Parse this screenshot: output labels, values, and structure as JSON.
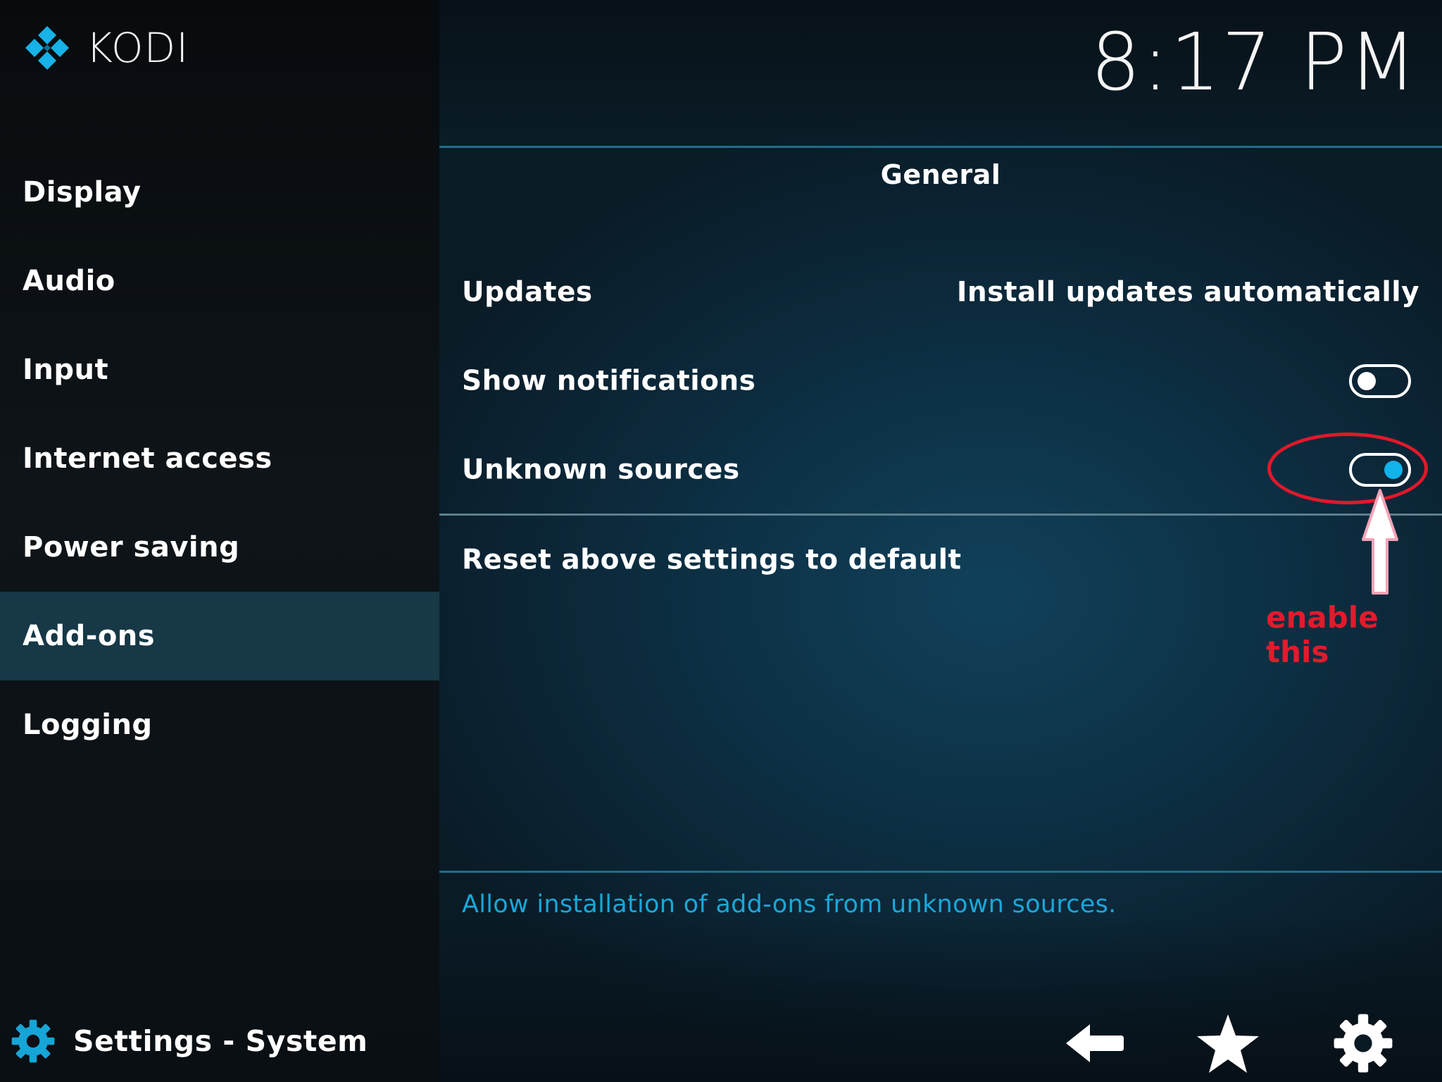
{
  "app": {
    "brand": "KODI",
    "clock": "8:17 PM"
  },
  "sidebar": {
    "items": [
      {
        "label": "Display",
        "selected": false
      },
      {
        "label": "Audio",
        "selected": false
      },
      {
        "label": "Input",
        "selected": false
      },
      {
        "label": "Internet access",
        "selected": false
      },
      {
        "label": "Power saving",
        "selected": false
      },
      {
        "label": "Add-ons",
        "selected": true
      },
      {
        "label": "Logging",
        "selected": false
      }
    ],
    "footer": {
      "icon": "gear-icon",
      "label": "Settings - System"
    }
  },
  "main": {
    "section_title": "General",
    "settings": [
      {
        "label": "Updates",
        "value": "Install updates automatically"
      },
      {
        "label": "Show notifications",
        "toggle": "off"
      },
      {
        "label": "Unknown sources",
        "toggle": "on"
      },
      {
        "label": "Reset above settings to default"
      }
    ],
    "description": "Allow installation of add-ons from unknown sources."
  },
  "annotation": {
    "text": "enable this",
    "color": "#e0192a"
  },
  "footer_icons": [
    "back-arrow-icon",
    "favourites-star-icon",
    "settings-gear-icon"
  ],
  "colors": {
    "accent": "#12b2ea",
    "selected_bg": "#163847",
    "description": "#1aa7d8"
  }
}
